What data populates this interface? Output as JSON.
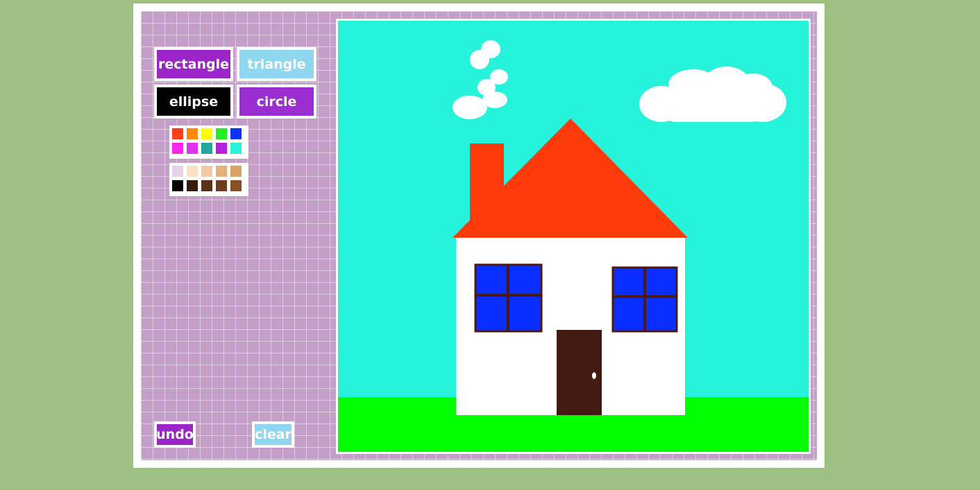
{
  "tools": {
    "shapes": [
      {
        "label": "rectangle",
        "color": "#9b25c9"
      },
      {
        "label": "triangle",
        "color": "#8fd6f1"
      },
      {
        "label": "ellipse",
        "color": "#000000"
      },
      {
        "label": "circle",
        "color": "#9b2ed0"
      }
    ],
    "undo_label": "undo",
    "undo_color": "#9b25c9",
    "clear_label": "clear",
    "clear_color": "#8fd6f1"
  },
  "palette_bright": [
    "#ff3b1a",
    "#ff8800",
    "#ffff00",
    "#22ee22",
    "#0a33ff",
    "#ff22ee",
    "#dd33ee",
    "#22a89a",
    "#b520e0",
    "#28f2d8"
  ],
  "palette_tones": [
    "#e8d0e8",
    "#ffe0c4",
    "#f4c8a4",
    "#e6b07a",
    "#d9a260",
    "#000000",
    "#3a1a08",
    "#5a3018",
    "#6e3c20",
    "#8a5024"
  ],
  "drawing": {
    "sky_color": "#27f2dc",
    "grass_color": "#00ff00",
    "wall_color": "#ffffff",
    "roof_color": "#ff3a0a",
    "window_color": "#0a2eff",
    "frame_color": "#4a1a10",
    "door_color": "#431b10",
    "cloud_color": "#ffffff"
  }
}
